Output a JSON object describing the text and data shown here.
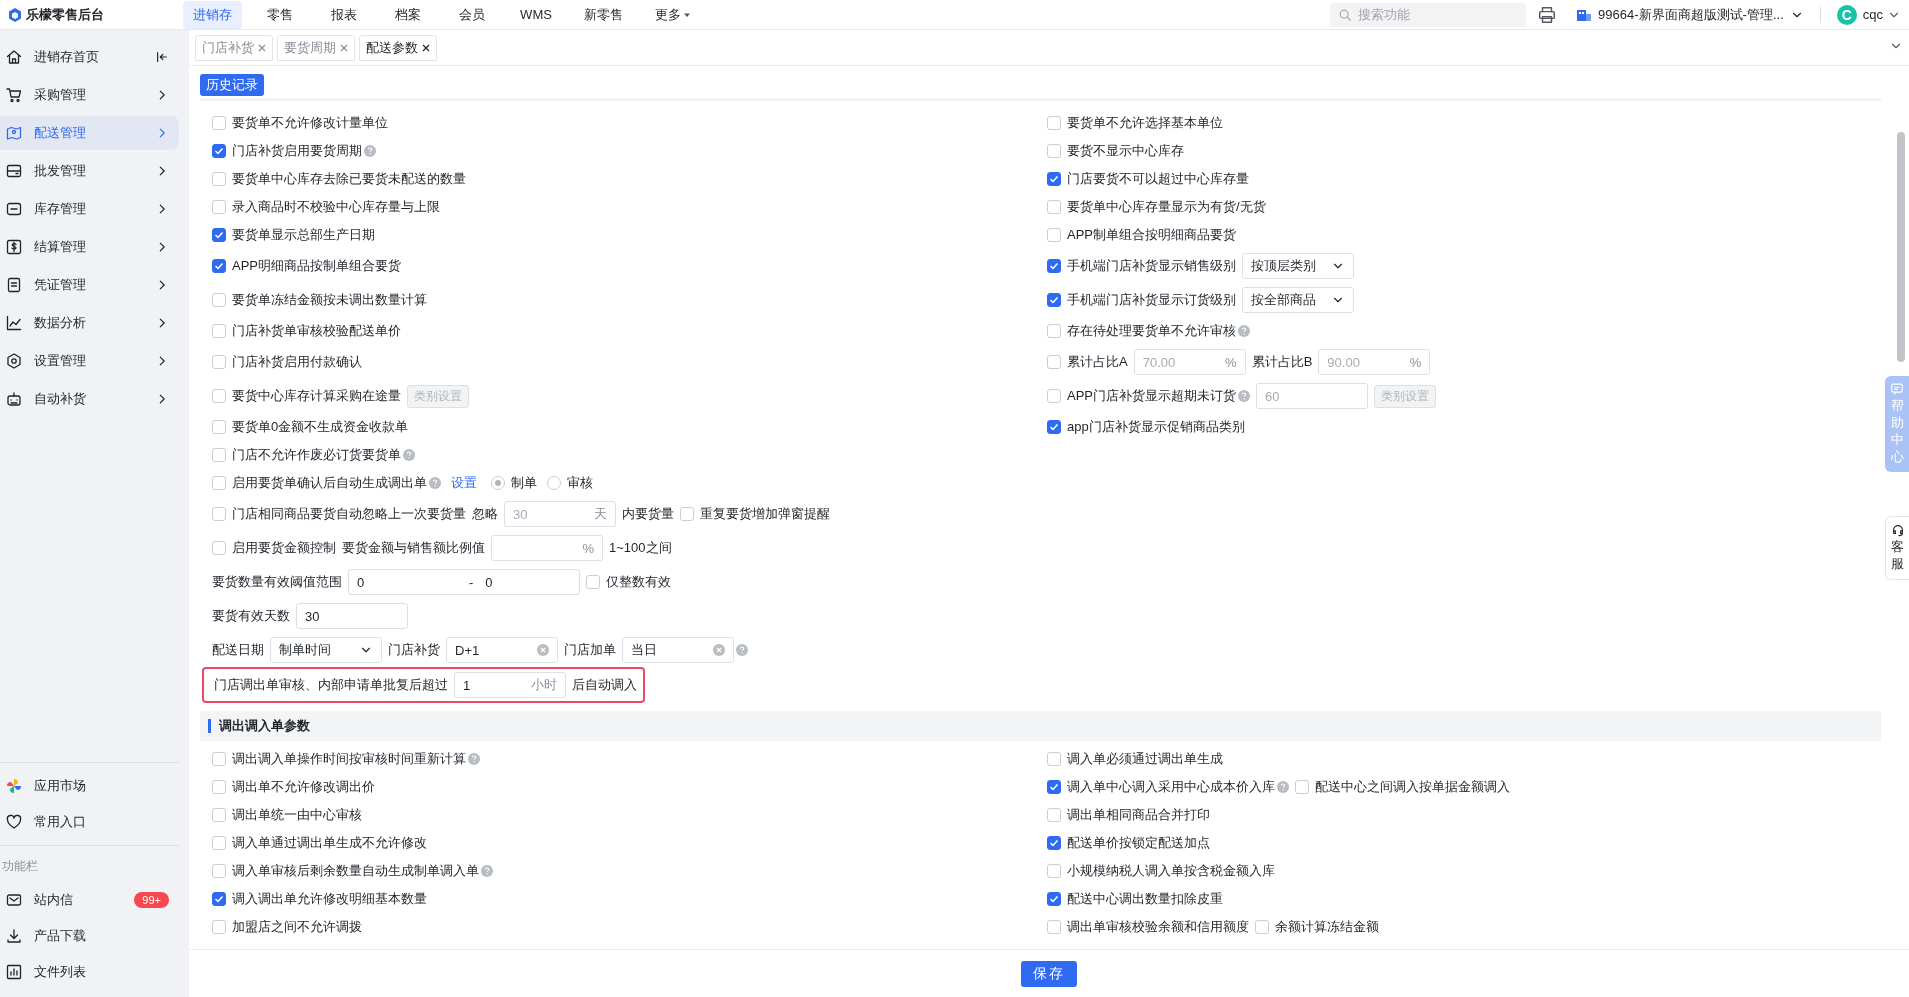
{
  "app": {
    "title": "乐檬零售后台"
  },
  "nav": [
    {
      "label": "进销存",
      "selected": true,
      "has_menu": false
    },
    {
      "label": "零售",
      "selected": false,
      "has_menu": false
    },
    {
      "label": "报表",
      "selected": false,
      "has_menu": false
    },
    {
      "label": "档案",
      "selected": false,
      "has_menu": false
    },
    {
      "label": "会员",
      "selected": false,
      "has_menu": false
    },
    {
      "label": "WMS",
      "selected": false,
      "has_menu": false
    },
    {
      "label": "新零售",
      "selected": false,
      "has_menu": false
    },
    {
      "label": "更多",
      "selected": false,
      "has_menu": true
    }
  ],
  "search": {
    "placeholder": "搜索功能"
  },
  "store": {
    "label": "99664-新界面商超版测试-管理..."
  },
  "user": {
    "avatar": "C",
    "name": "cqc"
  },
  "tabs": [
    {
      "label": "门店补货",
      "selected": false
    },
    {
      "label": "要货周期",
      "selected": false
    },
    {
      "label": "配送参数",
      "selected": true
    }
  ],
  "sidebar": {
    "home": {
      "label": "进销存首页"
    },
    "items": [
      {
        "label": "采购管理",
        "selected": false
      },
      {
        "label": "配送管理",
        "selected": true
      },
      {
        "label": "批发管理",
        "selected": false
      },
      {
        "label": "库存管理",
        "selected": false
      },
      {
        "label": "结算管理",
        "selected": false
      },
      {
        "label": "凭证管理",
        "selected": false
      },
      {
        "label": "数据分析",
        "selected": false
      },
      {
        "label": "设置管理",
        "selected": false
      },
      {
        "label": "自动补货",
        "selected": false
      }
    ],
    "shortcuts": [
      {
        "label": "应用市场"
      },
      {
        "label": "常用入口"
      }
    ],
    "section_label": "功能栏",
    "function_items": [
      {
        "label": "站内信",
        "badge": "99+"
      },
      {
        "label": "产品下载"
      },
      {
        "label": "文件列表"
      }
    ]
  },
  "history_button": "历史记录",
  "settings": {
    "rows": [
      {
        "cells": [
          [
            {
              "kind": "checkbox",
              "label": "要货单不允许修改计量单位",
              "checked": false
            }
          ],
          [
            {
              "kind": "checkbox",
              "label": "要货单不允许选择基本单位",
              "checked": false
            }
          ]
        ]
      },
      {
        "cells": [
          [
            {
              "kind": "checkbox",
              "label": "门店补货启用要货周期",
              "checked": true
            },
            {
              "kind": "help"
            }
          ],
          [
            {
              "kind": "checkbox",
              "label": "要货不显示中心库存",
              "checked": false
            }
          ]
        ]
      },
      {
        "cells": [
          [
            {
              "kind": "checkbox",
              "label": "要货单中心库存去除已要货未配送的数量",
              "checked": false
            }
          ],
          [
            {
              "kind": "checkbox",
              "label": "门店要货不可以超过中心库存量",
              "checked": true
            }
          ]
        ]
      },
      {
        "cells": [
          [
            {
              "kind": "checkbox",
              "label": "录入商品时不校验中心库存量与上限",
              "checked": false
            }
          ],
          [
            {
              "kind": "checkbox",
              "label": "要货单中心库存量显示为有货/无货",
              "checked": false
            }
          ]
        ]
      },
      {
        "cells": [
          [
            {
              "kind": "checkbox",
              "label": "要货单显示总部生产日期",
              "checked": true
            }
          ],
          [
            {
              "kind": "checkbox",
              "label": "APP制单组合按明细商品要货",
              "checked": false
            }
          ]
        ]
      },
      {
        "cells": [
          [
            {
              "kind": "checkbox",
              "label": "APP明细商品按制单组合要货",
              "checked": true
            }
          ],
          [
            {
              "kind": "checkbox",
              "label": "手机端门店补货显示销售级别",
              "checked": true
            },
            {
              "kind": "select",
              "value": "按顶层类别"
            }
          ]
        ]
      },
      {
        "cells": [
          [
            {
              "kind": "checkbox",
              "label": "要货单冻结金额按未调出数量计算",
              "checked": false
            }
          ],
          [
            {
              "kind": "checkbox",
              "label": "手机端门店补货显示订货级别",
              "checked": true
            },
            {
              "kind": "select",
              "value": "按全部商品"
            }
          ]
        ]
      },
      {
        "cells": [
          [
            {
              "kind": "checkbox",
              "label": "门店补货单审核校验配送单价",
              "checked": false
            }
          ],
          [
            {
              "kind": "checkbox",
              "label": "存在待处理要货单不允许审核",
              "checked": false
            },
            {
              "kind": "help"
            }
          ]
        ]
      },
      {
        "cells": [
          [
            {
              "kind": "checkbox",
              "label": "门店补货启用付款确认",
              "checked": false
            }
          ],
          [
            {
              "kind": "checkbox",
              "label": "累计占比A",
              "checked": false
            },
            {
              "kind": "input",
              "placeholder": "70.00",
              "suffix": "%"
            },
            {
              "kind": "text",
              "label": "累计占比B"
            },
            {
              "kind": "input",
              "placeholder": "90.00",
              "suffix": "%"
            }
          ]
        ]
      },
      {
        "cells": [
          [
            {
              "kind": "checkbox",
              "label": "要货中心库存计算采购在途量",
              "checked": false
            },
            {
              "kind": "button",
              "label": "类别设置",
              "disabled": true
            }
          ],
          [
            {
              "kind": "checkbox",
              "label": "APP门店补货显示超期未订货",
              "checked": false
            },
            {
              "kind": "help"
            },
            {
              "kind": "input",
              "placeholder": "60"
            },
            {
              "kind": "button",
              "label": "类别设置",
              "disabled": true
            }
          ]
        ]
      },
      {
        "cells": [
          [
            {
              "kind": "checkbox",
              "label": "要货单0金额不生成资金收款单",
              "checked": false
            }
          ],
          [
            {
              "kind": "checkbox",
              "label": "app门店补货显示促销商品类别",
              "checked": true
            }
          ]
        ]
      },
      {
        "cells": [
          [
            {
              "kind": "checkbox",
              "label": "门店不允许作废必订货要货单",
              "checked": false
            },
            {
              "kind": "help"
            }
          ]
        ]
      },
      {
        "cells": [
          [
            {
              "kind": "checkbox",
              "label": "启用要货单确认后自动生成调出单",
              "checked": false
            },
            {
              "kind": "help"
            },
            {
              "kind": "link",
              "label": "设置"
            },
            {
              "kind": "radio",
              "label": "制单",
              "selected": true
            },
            {
              "kind": "radio",
              "label": "审核",
              "selected": false
            }
          ]
        ]
      },
      {
        "cells": [
          [
            {
              "kind": "checkbox",
              "label": "门店相同商品要货自动忽略上一次要货量",
              "checked": false
            },
            {
              "kind": "text",
              "label": "忽略"
            },
            {
              "kind": "input",
              "placeholder": "30",
              "suffix": "天"
            },
            {
              "kind": "text",
              "label": "内要货量"
            },
            {
              "kind": "checkbox",
              "label": "重复要货增加弹窗提醒",
              "checked": false
            }
          ]
        ]
      },
      {
        "cells": [
          [
            {
              "kind": "checkbox",
              "label": "启用要货金额控制",
              "checked": false
            },
            {
              "kind": "text",
              "label": "要货金额与销售额比例值"
            },
            {
              "kind": "input",
              "suffix": "%"
            },
            {
              "kind": "text",
              "label": "1~100之间"
            }
          ]
        ]
      },
      {
        "cells": [
          [
            {
              "kind": "text",
              "label": "要货数量有效阈值范围"
            },
            {
              "kind": "range",
              "from": "0",
              "separator": "-",
              "to": "0"
            },
            {
              "kind": "checkbox",
              "label": "仅整数有效",
              "checked": false
            }
          ]
        ]
      },
      {
        "cells": [
          [
            {
              "kind": "text",
              "label": "要货有效天数"
            },
            {
              "kind": "input",
              "value": "30"
            }
          ]
        ]
      },
      {
        "cells": [
          [
            {
              "kind": "text",
              "label": "配送日期"
            },
            {
              "kind": "select",
              "value": "制单时间"
            },
            {
              "kind": "text",
              "label": "门店补货"
            },
            {
              "kind": "clearable",
              "value": "D+1"
            },
            {
              "kind": "text",
              "label": "门店加单"
            },
            {
              "kind": "clearable",
              "value": "当日"
            },
            {
              "kind": "help"
            }
          ]
        ]
      }
    ],
    "highlight_box": [
      {
        "kind": "text",
        "label": "门店调出单审核、内部申请单批复后超过"
      },
      {
        "kind": "input",
        "value": "1",
        "suffix": "小时"
      },
      {
        "kind": "text",
        "label": "后自动调入"
      }
    ]
  },
  "section": {
    "title": "调出调入单参数",
    "rows": [
      {
        "cells": [
          [
            {
              "kind": "checkbox",
              "label": "调出调入单操作时间按审核时间重新计算",
              "checked": false
            },
            {
              "kind": "help"
            }
          ],
          [
            {
              "kind": "checkbox",
              "label": "调入单必须通过调出单生成",
              "checked": false
            }
          ]
        ]
      },
      {
        "cells": [
          [
            {
              "kind": "checkbox",
              "label": "调出单不允许修改调出价",
              "checked": false
            }
          ],
          [
            {
              "kind": "checkbox",
              "label": "调入单中心调入采用中心成本价入库",
              "checked": true
            },
            {
              "kind": "help"
            },
            {
              "kind": "checkbox",
              "label": "配送中心之间调入按单据金额调入",
              "checked": false
            }
          ]
        ]
      },
      {
        "cells": [
          [
            {
              "kind": "checkbox",
              "label": "调出单统一由中心审核",
              "checked": false
            }
          ],
          [
            {
              "kind": "checkbox",
              "label": "调出单相同商品合并打印",
              "checked": false
            }
          ]
        ]
      },
      {
        "cells": [
          [
            {
              "kind": "checkbox",
              "label": "调入单通过调出单生成不允许修改",
              "checked": false
            }
          ],
          [
            {
              "kind": "checkbox",
              "label": "配送单价按锁定配送加点",
              "checked": true
            }
          ]
        ]
      },
      {
        "cells": [
          [
            {
              "kind": "checkbox",
              "label": "调入单审核后剩余数量自动生成制单调入单",
              "checked": false
            },
            {
              "kind": "help"
            }
          ],
          [
            {
              "kind": "checkbox",
              "label": "小规模纳税人调入单按含税金额入库",
              "checked": false
            }
          ]
        ]
      },
      {
        "cells": [
          [
            {
              "kind": "checkbox",
              "label": "调入调出单允许修改明细基本数量",
              "checked": true
            }
          ],
          [
            {
              "kind": "checkbox",
              "label": "配送中心调出数量扣除皮重",
              "checked": true
            }
          ]
        ]
      },
      {
        "cells": [
          [
            {
              "kind": "checkbox",
              "label": "加盟店之间不允许调拨",
              "checked": false
            }
          ],
          [
            {
              "kind": "checkbox",
              "label": "调出单审核校验余额和信用额度",
              "checked": false
            },
            {
              "kind": "checkbox",
              "label": "余额计算冻结金额",
              "checked": false
            }
          ]
        ]
      }
    ]
  },
  "save_button": "保存",
  "side_tabs": [
    {
      "label": "帮助中心"
    },
    {
      "label": "客服"
    }
  ]
}
